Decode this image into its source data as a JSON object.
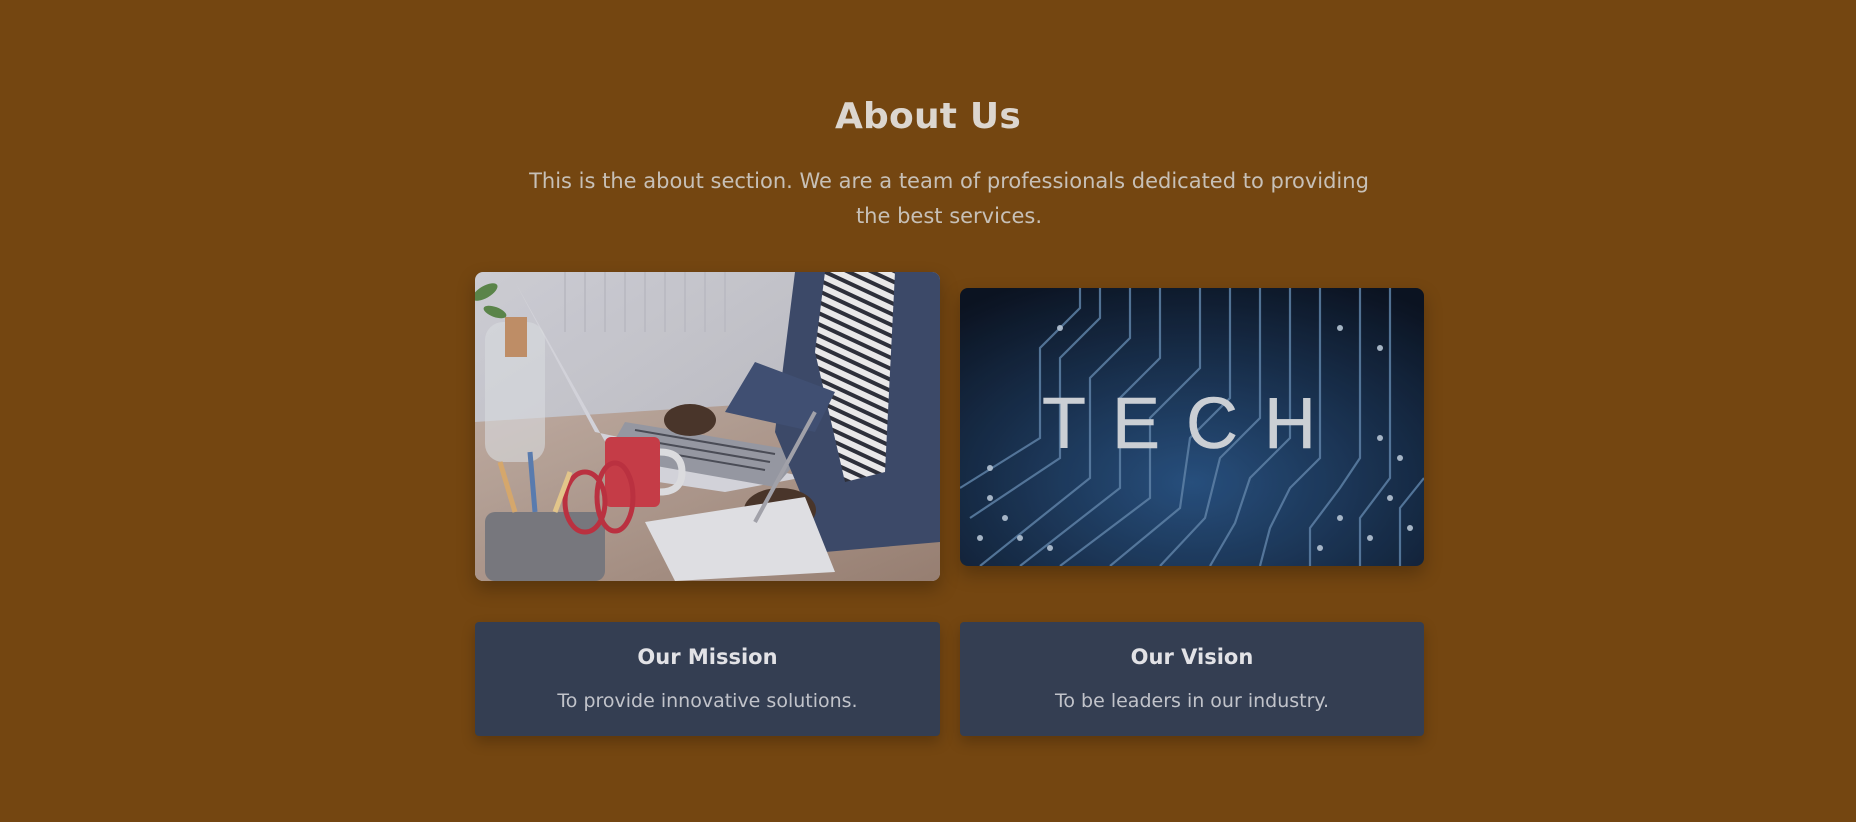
{
  "about": {
    "title": "About Us",
    "intro": "This is the about section. We are a team of professionals dedicated to providing the best services."
  },
  "images": [
    {
      "icon": "laptop-workspace-photo"
    },
    {
      "icon": "tech-circuit-board-photo",
      "text": "TECH"
    }
  ],
  "cards": [
    {
      "title": "Our Mission",
      "text": "To provide innovative solutions."
    },
    {
      "title": "Our Vision",
      "text": "To be leaders in our industry."
    }
  ],
  "colors": {
    "background": "#744611",
    "card": "#343e52",
    "heading": "#dcd6cf"
  }
}
